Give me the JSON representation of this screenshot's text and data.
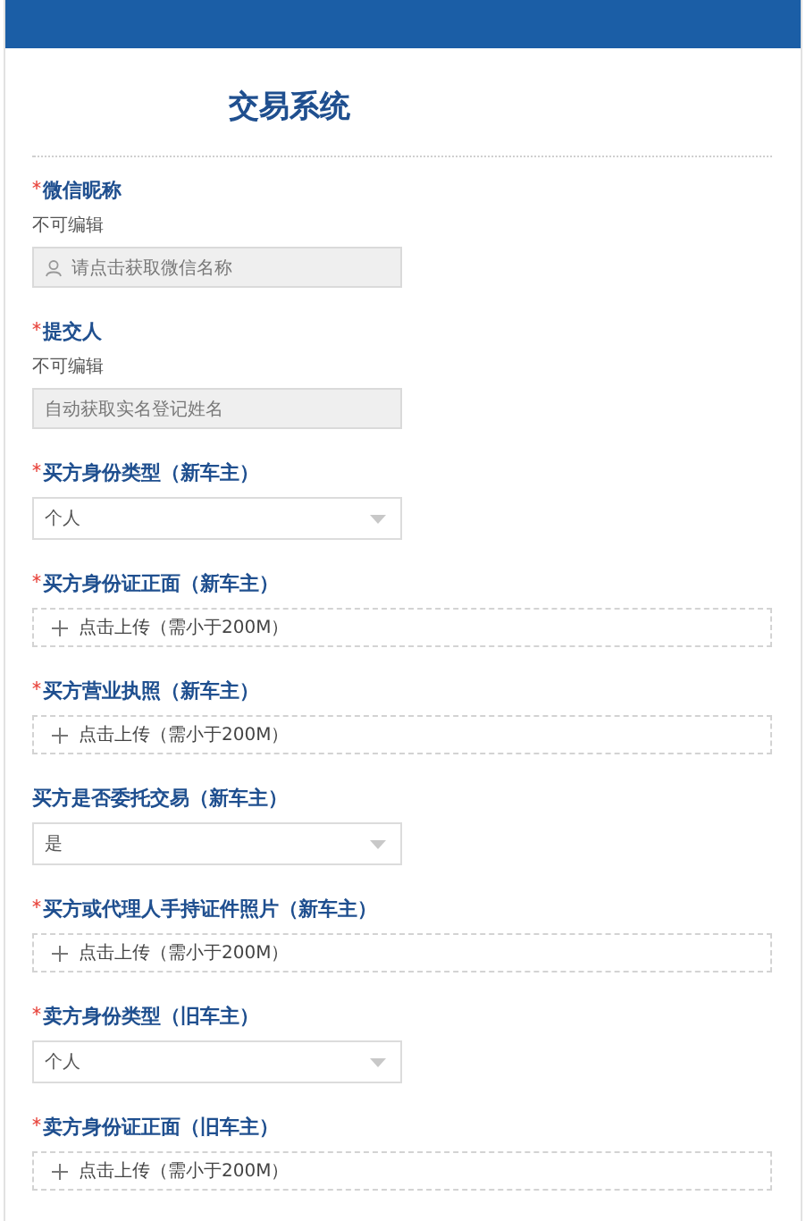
{
  "header": {
    "title": "交易系统"
  },
  "fields": [
    {
      "kind": "readonly",
      "label": "微信昵称",
      "required": true,
      "hint": "不可编辑",
      "placeholder": "请点击获取微信名称",
      "user_icon": true
    },
    {
      "kind": "readonly",
      "label": "提交人",
      "required": true,
      "hint": "不可编辑",
      "placeholder": "自动获取实名登记姓名",
      "user_icon": false
    },
    {
      "kind": "select",
      "label": "买方身份类型（新车主）",
      "required": true,
      "value": "个人"
    },
    {
      "kind": "upload",
      "label": "买方身份证正面（新车主）",
      "required": true,
      "text": "点击上传（需小于200M）"
    },
    {
      "kind": "upload",
      "label": "买方营业执照（新车主）",
      "required": true,
      "text": "点击上传（需小于200M）"
    },
    {
      "kind": "select",
      "label": "买方是否委托交易（新车主）",
      "required": false,
      "value": "是"
    },
    {
      "kind": "upload",
      "label": "买方或代理人手持证件照片（新车主）",
      "required": true,
      "text": "点击上传（需小于200M）"
    },
    {
      "kind": "select",
      "label": "卖方身份类型（旧车主）",
      "required": true,
      "value": "个人"
    },
    {
      "kind": "upload",
      "label": "卖方身份证正面（旧车主）",
      "required": true,
      "text": "点击上传（需小于200M）"
    }
  ]
}
